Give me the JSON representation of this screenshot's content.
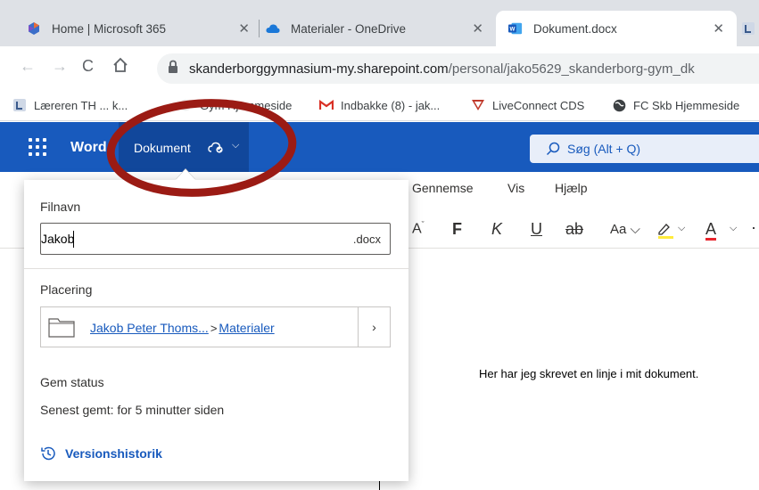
{
  "browser": {
    "tabs": [
      {
        "title": "Home | Microsoft 365",
        "icon": "microsoft365-icon"
      },
      {
        "title": "Materialer - OneDrive",
        "icon": "onedrive-cloud-icon"
      },
      {
        "title": "Dokument.docx",
        "icon": "word-icon",
        "active": true
      }
    ],
    "url_host": "skanderborggymnasium-my.sharepoint.com",
    "url_path": "/personal/jako5629_skanderborg-gym_dk",
    "bookmarks": [
      {
        "label": "Læreren TH ... k...",
        "icon": "lectio-icon"
      },
      {
        "label": "Gym Hjemmeside",
        "icon": "school-logo-icon"
      },
      {
        "label": "Indbakke (8) - jak...",
        "icon": "gmail-icon"
      },
      {
        "label": "LiveConnect CDS",
        "icon": "liveconnect-icon"
      },
      {
        "label": "FC Skb Hjemmeside",
        "icon": "globe-icon"
      }
    ]
  },
  "word": {
    "app_name": "Word",
    "doc_title": "Dokument",
    "search_placeholder": "Søg (Alt + Q)",
    "ribbon_tabs": [
      "Gennemse",
      "Vis",
      "Hjælp"
    ],
    "ribbon_buttons": [
      "A",
      "F",
      "K",
      "U",
      "ab",
      "Aa",
      "A"
    ],
    "document_text": "Her har jeg skrevet en linje i mit dokument."
  },
  "panel": {
    "filename_label": "Filnavn",
    "filename_value": "Jakob",
    "filename_ext": ".docx",
    "location_label": "Placering",
    "location_path_1": "Jakob Peter Thoms...",
    "location_sep": ">",
    "location_path_2": "Materialer",
    "save_status_label": "Gem status",
    "save_status_value": "Senest gemt: for 5 minutter siden",
    "version_history_label": "Versionshistorik"
  },
  "colors": {
    "word_blue": "#185abd",
    "annotation_red": "#9b1b14"
  }
}
